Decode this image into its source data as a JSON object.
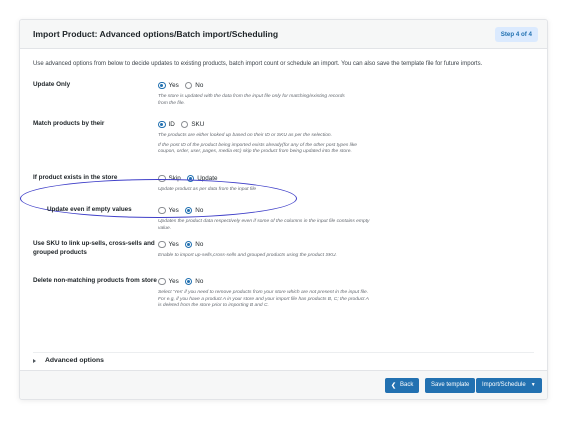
{
  "header": {
    "title": "Import Product: Advanced options/Batch import/Scheduling",
    "step": "Step 4 of 4"
  },
  "intro": "Use advanced options from below to decide updates to existing products, batch import count or schedule an import. You can also save the template file for future imports.",
  "options": {
    "update_only": {
      "label": "Update Only",
      "opt1": "Yes",
      "opt2": "No",
      "selected": "Yes",
      "help": "The store is updated with the data from the input file only for matching/existing records from the file."
    },
    "match_products": {
      "label": "Match products by their",
      "opt1": "ID",
      "opt2": "SKU",
      "selected": "ID",
      "help": "The products are either looked up based on their ID or SKU as per the selection.",
      "help2": "If the post ID of the product being imported exists already(for any of the other post types like coupon, order, user, pages, media etc) skip the product from being updated into the store."
    },
    "if_exists": {
      "label": "If product exists in the store",
      "opt1": "Skip",
      "opt2": "Update",
      "selected": "Update",
      "help": "Update product as per data from the input file"
    },
    "update_empty": {
      "label": "Update even if empty values",
      "opt1": "Yes",
      "opt2": "No",
      "selected": "No",
      "help": "Updates the product data respectively even if some of the columns in the input file contains empty value."
    },
    "use_sku": {
      "label": "Use SKU to link up-sells, cross-sells and grouped products",
      "opt1": "Yes",
      "opt2": "No",
      "selected": "No",
      "help": "Enable to import up-sells,cross-sells and grouped products using the product SKU."
    },
    "delete_nonmatching": {
      "label": "Delete non-matching products from store",
      "opt1": "Yes",
      "opt2": "No",
      "selected": "No",
      "help": "Select 'Yes' if you need to remove products from your store which are not present in the input file. For e.g, if you have a product A in your store and your import file has products B, C; the product A is deleted from the store prior to importing B and C."
    }
  },
  "advanced": {
    "label": "Advanced options"
  },
  "footer": {
    "back": "Back",
    "save_template": "Save template",
    "import_schedule": "Import/Schedule"
  },
  "colors": {
    "accent": "#2271b1",
    "highlight_ring": "#3f3fc8"
  }
}
